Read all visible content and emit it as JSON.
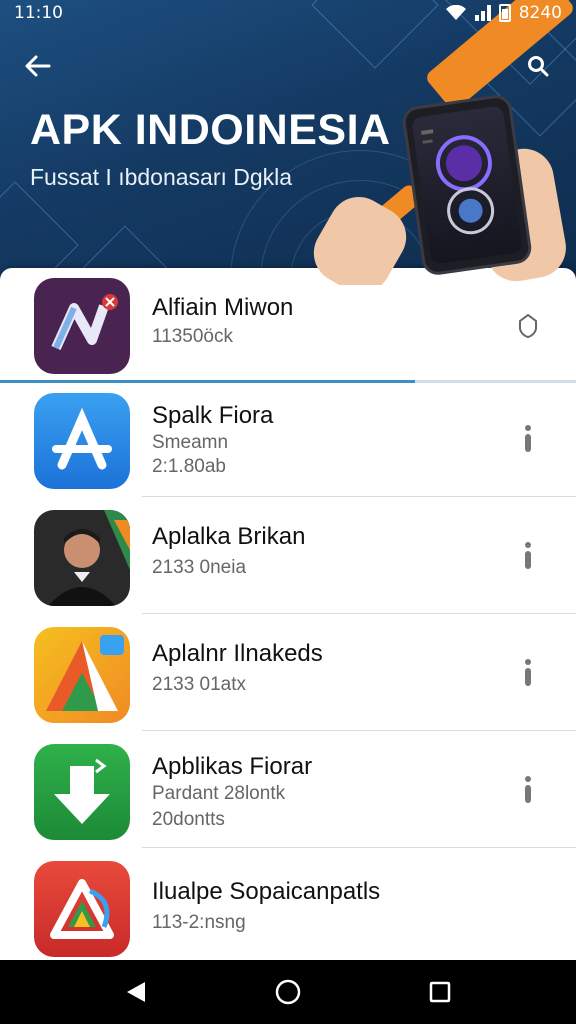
{
  "status_bar": {
    "time": "11:10",
    "right_text": "8240"
  },
  "header": {
    "title": "APK INDOINESIA",
    "subtitle": "Fussat I ıbdonasarı Dgkla",
    "back_icon": "arrow-left-icon",
    "search_icon": "search-icon"
  },
  "list_progress": 0.72,
  "apps": [
    {
      "name": "Alfiain Miwon",
      "lines": [
        "11350öck"
      ],
      "icon": "video-app-icon",
      "action_icon": "shield-icon"
    },
    {
      "name": "Spalk Fiora",
      "lines": [
        "Smeamn",
        "2:1.80ab"
      ],
      "icon": "app-store-icon",
      "action_icon": "more-vertical-icon"
    },
    {
      "name": "Aplalka Brikan",
      "lines": [
        "2133 0neia"
      ],
      "icon": "profile-photo-icon",
      "action_icon": "more-vertical-icon"
    },
    {
      "name": "Aplalnr Ilnakeds",
      "lines": [
        "2133 01atx"
      ],
      "icon": "triangle-app-icon",
      "action_icon": "more-vertical-icon"
    },
    {
      "name": "Apblikas Fiorar",
      "lines": [
        "Pardant 28lontk",
        "20dontts"
      ],
      "icon": "download-app-icon",
      "action_icon": "more-vertical-icon"
    },
    {
      "name": "Ilualpe Sopaicanpatls",
      "lines": [
        "113-2:nsng"
      ],
      "icon": "prism-app-icon",
      "action_icon": "none"
    }
  ],
  "navbar": {
    "back": "nav-back-icon",
    "home": "nav-home-icon",
    "recents": "nav-recents-icon"
  },
  "colors": {
    "header_bg": "#143a63",
    "accent": "#3d8fbf",
    "orange": "#f08a24"
  }
}
